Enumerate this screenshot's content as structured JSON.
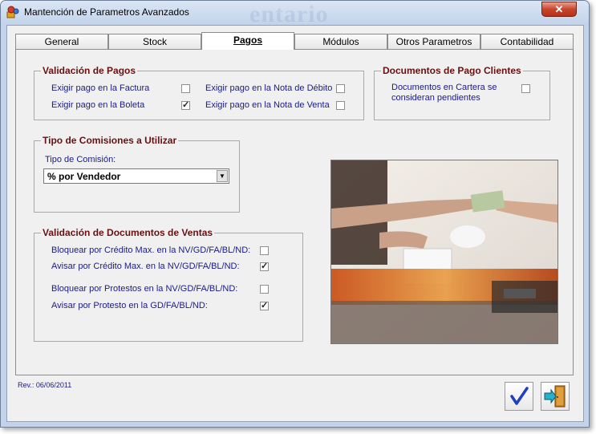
{
  "window": {
    "title": "Mantención de Parametros Avanzados",
    "watermark": "entario"
  },
  "tabs": [
    {
      "label": "General"
    },
    {
      "label": "Stock"
    },
    {
      "label": "Pagos",
      "active": true
    },
    {
      "label": "Módulos"
    },
    {
      "label": "Otros Parametros"
    },
    {
      "label": "Contabilidad"
    }
  ],
  "validacion_pagos": {
    "title": "Validación de Pagos",
    "items": [
      {
        "label": "Exigir pago en la Factura",
        "checked": false
      },
      {
        "label": "Exigir pago en la Boleta",
        "checked": true
      },
      {
        "label": "Exigir pago en la Nota de Débito",
        "checked": false
      },
      {
        "label": "Exigir pago en la Nota de Venta",
        "checked": false
      }
    ]
  },
  "documentos_pago": {
    "title": "Documentos de Pago Clientes",
    "label_line1": "Documentos en Cartera se",
    "label_line2": "consideran pendientes",
    "checked": false
  },
  "tipo_comisiones": {
    "title": "Tipo de Comisiones a Utilizar",
    "field_label": "Tipo de Comisión:",
    "selected": "% por Vendedor"
  },
  "validacion_docs": {
    "title": "Validación de Documentos de Ventas",
    "items": [
      {
        "label": "Bloquear por Crédito Max. en la NV/GD/FA/BL/ND:",
        "checked": false
      },
      {
        "label": "Avisar por Crédito Max. en la NV/GD/FA/BL/ND:",
        "checked": true
      },
      {
        "label": "Bloquear por Protestos en la NV/GD/FA/BL/ND:",
        "checked": false
      },
      {
        "label": "Avisar por Protesto en la GD/FA/BL/ND:",
        "checked": true
      }
    ]
  },
  "footer": {
    "revision": "Rev.: 06/06/2011"
  },
  "check_glyph": "✓",
  "colors": {
    "group_title": "#6b0f0f",
    "label_text": "#1a1a8a",
    "accept_check": "#1e3fbf"
  }
}
